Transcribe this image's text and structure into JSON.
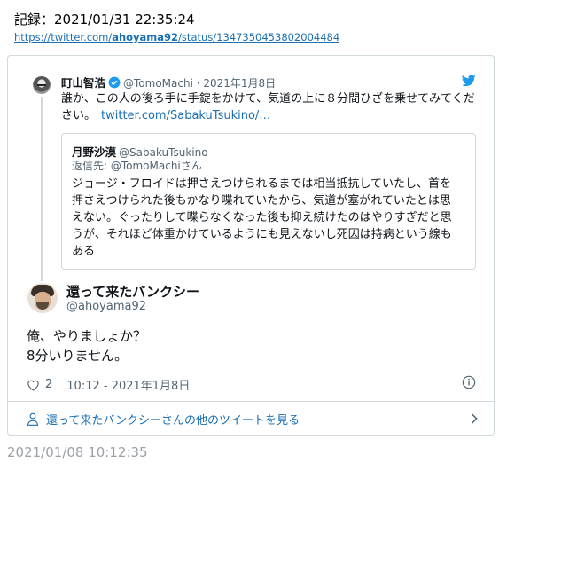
{
  "record": {
    "label": "記録：2021/01/31 22:35:24"
  },
  "source_url": {
    "prefix": "https://twitter.com/",
    "user": "ahoyama92",
    "suffix": "/status/1347350453802004484"
  },
  "quoted_tweet": {
    "name": "町山智浩",
    "handle_date": "@TomoMachi · 2021年1月8日",
    "text": "誰か、この人の後ろ手に手錠をかけて、気道の上に８分間ひざを乗せてみてください。",
    "link": "twitter.com/SabakuTsukino/…"
  },
  "inner_quote": {
    "name": "月野沙漠",
    "handle": "@SabakuTsukino",
    "reply_to": "返信先: @TomoMachiさん",
    "text": "ジョージ・フロイドは押さえつけられるまでは相当抵抗していたし、首を押さえつけられた後もかなり喋れていたから、気道が塞がれていたとは思えない。ぐったりして喋らなくなった後も抑え続けたのはやりすぎだと思うが、それほど体重かけているようにも見えないし死因は持病という線もある"
  },
  "main_tweet": {
    "name": "還って来たバンクシー",
    "handle": "@ahoyama92",
    "text_line1": "俺、やりましょか？",
    "text_line2": "8分いりません。",
    "likes": "2",
    "time": "10:12 - 2021年1月8日"
  },
  "more_tweets": {
    "label": "還って来たバンクシーさんの他のツイートを見る"
  },
  "archive_timestamp": "2021/01/08 10:12:35",
  "colors": {
    "link": "#1b6fb3",
    "twitter_blue": "#1d9bf0",
    "border": "#cfd9de",
    "muted": "#536471"
  }
}
